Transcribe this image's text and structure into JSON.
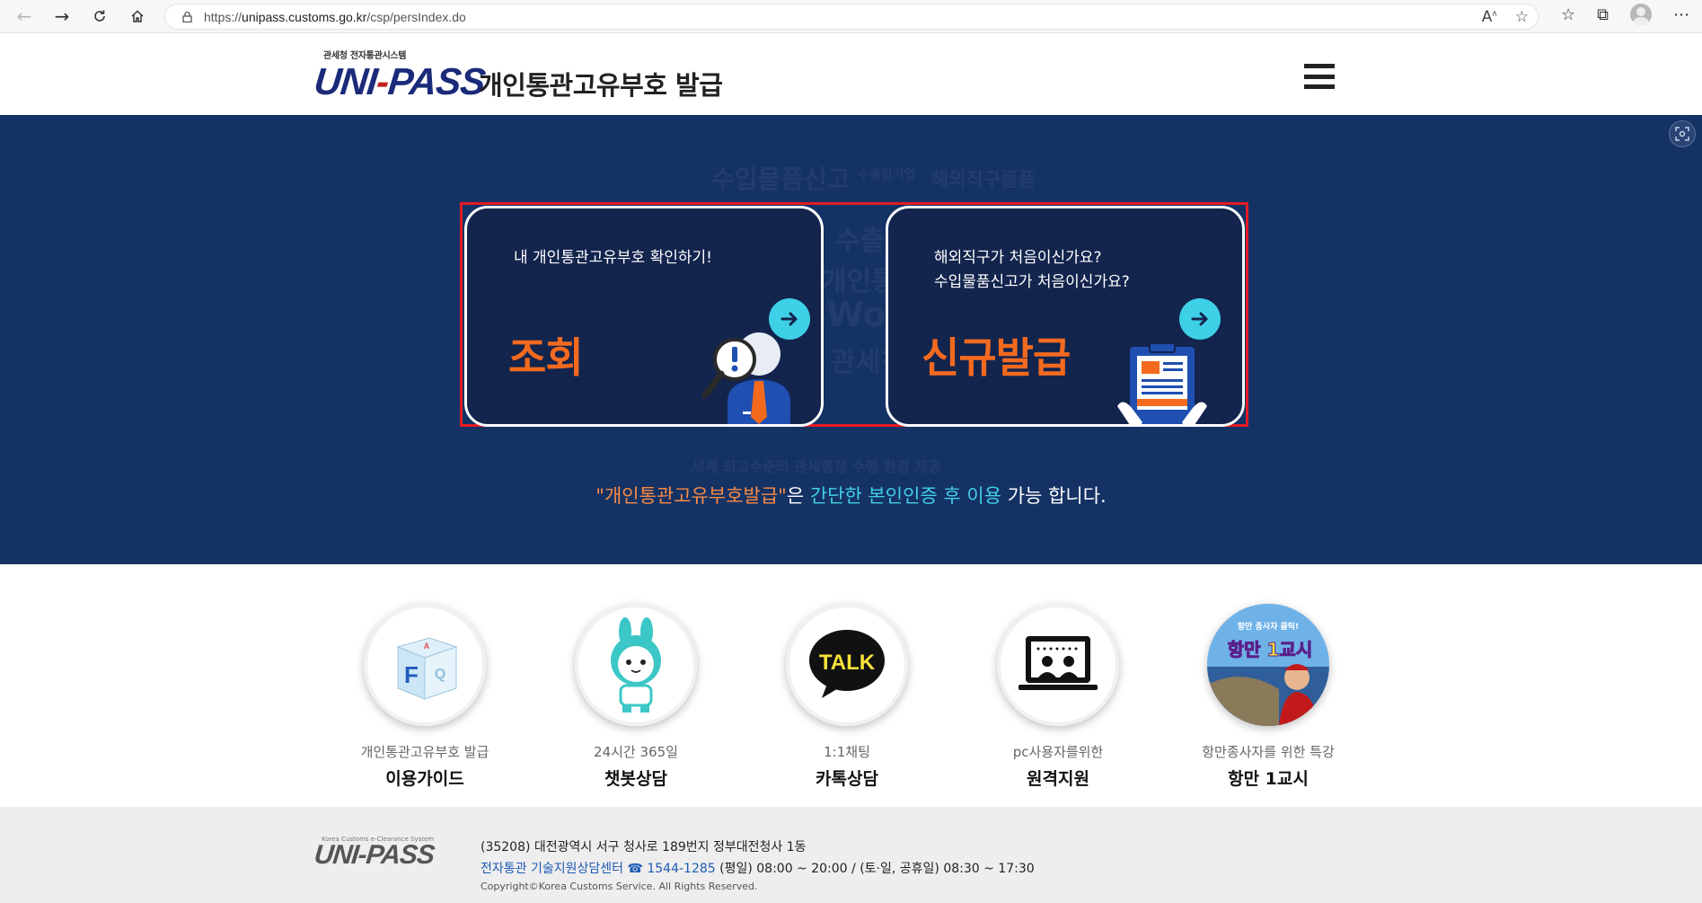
{
  "browser": {
    "url_prefix": "https://",
    "url_host": "unipass.customs.go.kr",
    "url_path": "/csp/persIndex.do"
  },
  "header": {
    "brand_small": "관세청 전자통관시스템",
    "logo_text_a": "UNI",
    "logo_text_dash": "-",
    "logo_text_b": "PASS",
    "title": "개인통관고유부호 발급"
  },
  "hero": {
    "watermarks": [
      "수입물품신고",
      "수출입기업",
      "해외직구물품",
      "수출",
      "개인통관",
      "World",
      "관세청",
      "세계 최고수준의 관세행정 수행 환경 제공"
    ],
    "cards": [
      {
        "text": [
          "내 개인통관고유부호 확인하기!"
        ],
        "title": "조회"
      },
      {
        "text": [
          "해외직구가 처음이신가요?",
          "수입물품신고가 처음이신가요?"
        ],
        "title": "신규발급"
      }
    ],
    "caption": {
      "part1": "\"개인통관고유부호발급\"",
      "part2": "은 ",
      "part3": "간단한 본인인증 후 이용",
      "part4": " 가능 합니다."
    }
  },
  "services": [
    {
      "sub": "개인통관고유부호 발급",
      "main": "이용가이드",
      "icon": "faq-cube-icon"
    },
    {
      "sub": "24시간 365일",
      "main": "챗봇상담",
      "icon": "chatbot-rabbit-icon"
    },
    {
      "sub": "1:1채팅",
      "main": "카톡상담",
      "icon": "kakao-talk-icon"
    },
    {
      "sub": "pc사용자를위한",
      "main": "원격지원",
      "icon": "remote-support-icon"
    },
    {
      "sub": "항만종사자를 위한 특강",
      "main": "항만 1교시",
      "icon": "port-lecture-icon"
    }
  ],
  "service_badge_text": [
    "항만 종사자 클릭!",
    "항만 1교시"
  ],
  "faq_letter": "F",
  "talk_label": "TALK",
  "footer": {
    "logo_small": "Korea Customs e-Clearance System",
    "logo": "UNI-PASS",
    "address": "(35208) 대전광역시 서구 청사로 189번지 정부대전청사 1동",
    "center_name": "전자통관 기술지원상담센터",
    "center_phone": "☎ 1544-1285",
    "center_hours": " (평일) 08:00 ~ 20:00 / (토·일, 공휴일) 08:30 ~ 17:30",
    "copyright": "Copyright©Korea Customs Service. All Rights Reserved."
  },
  "colors": {
    "hero_bg": "#153265",
    "card_bg": "#13244d",
    "accent_orange": "#f36a1f",
    "accent_cyan": "#3ed0e6",
    "highlight_frame": "#e31b23"
  }
}
